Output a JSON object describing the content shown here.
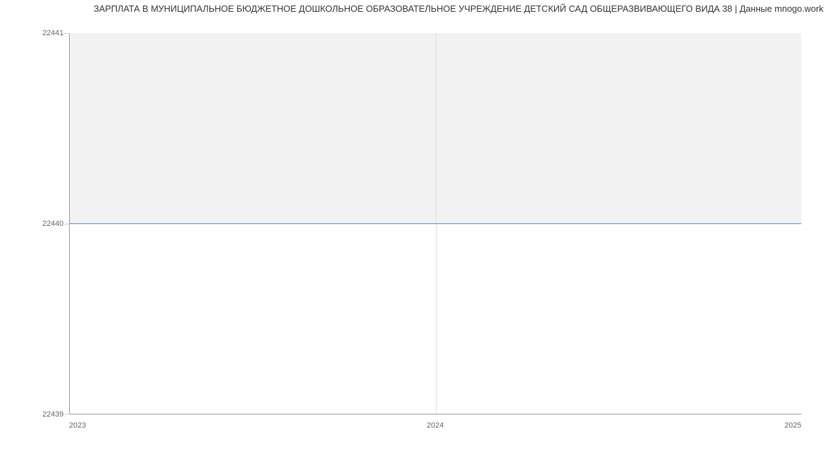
{
  "chart_data": {
    "type": "line",
    "title": "ЗАРПЛАТА В МУНИЦИПАЛЬНОЕ БЮДЖЕТНОЕ ДОШКОЛЬНОЕ ОБРАЗОВАТЕЛЬНОЕ УЧРЕЖДЕНИЕ ДЕТСКИЙ САД ОБЩЕРАЗВИВАЮЩЕГО ВИДА 38 | Данные mnogo.work",
    "x": [
      2023,
      2024,
      2025
    ],
    "values": [
      22440,
      22440,
      22440
    ],
    "xlabel": "",
    "ylabel": "",
    "ylim": [
      22439,
      22441
    ],
    "x_tick_labels": [
      "2023",
      "2024",
      "2025"
    ],
    "y_tick_labels": [
      "22441",
      "22440",
      "22439"
    ]
  }
}
